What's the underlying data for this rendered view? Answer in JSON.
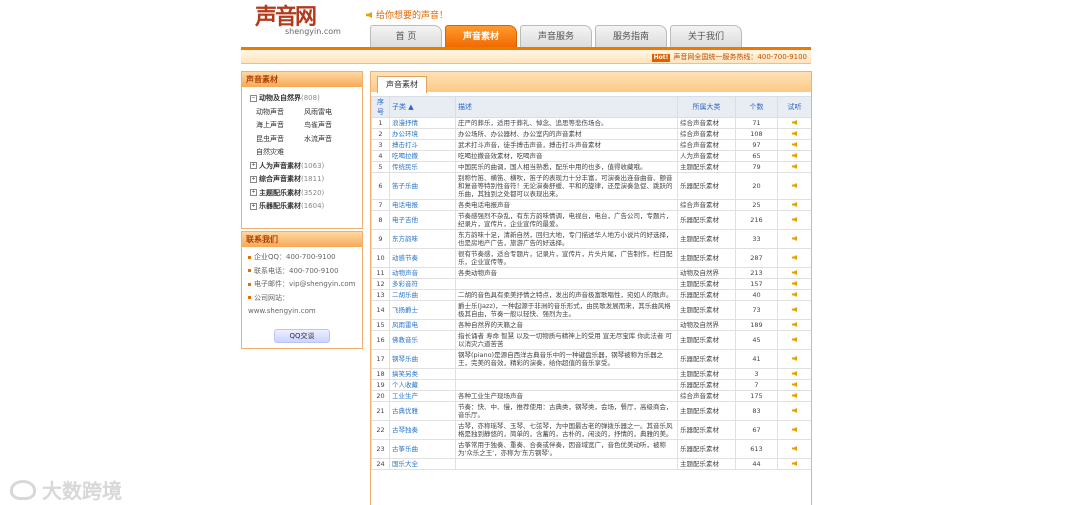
{
  "header": {
    "logo_text": "声音网",
    "logo_sub": "shengyin.com",
    "slogan": "给你想要的声音！",
    "hotline_badge": "Hot!",
    "hotline": "声音网全国统一服务热线：400-700-9100"
  },
  "nav": {
    "tabs": [
      {
        "label": "首 页"
      },
      {
        "label": "声音素材",
        "active": true
      },
      {
        "label": "声音服务"
      },
      {
        "label": "服务指南"
      },
      {
        "label": "关于我们"
      }
    ]
  },
  "sidebar": {
    "title": "声音素材",
    "categories": [
      {
        "label": "动物及自然界",
        "count": "(808)",
        "expanded": true,
        "children": [
          "动物声音",
          "风雨雷电",
          "海上声音",
          "鸟雀声音",
          "昆虫声音",
          "水流声音",
          "自然灾难"
        ]
      },
      {
        "label": "人为声音素材",
        "count": "(1063)"
      },
      {
        "label": "综合声音素材",
        "count": "(1811)"
      },
      {
        "label": "主题配乐素材",
        "count": "(3520)"
      },
      {
        "label": "乐器配乐素材",
        "count": "(1604)"
      }
    ],
    "contact": {
      "title": "联系我们",
      "rows": [
        "企业QQ：400-700-9100",
        "联系电话：400-700-9100",
        "电子邮件：vip@shengyin.com",
        "公司网站：www.shengyin.com"
      ],
      "qq_button": "QQ交谈"
    }
  },
  "main": {
    "tab": "声音素材",
    "columns": [
      "序号",
      "子类 ▲",
      "描述",
      "所属大类",
      "个数",
      "试听"
    ],
    "rows": [
      {
        "num": "1",
        "name": "浪漫抒情",
        "desc": "庄严的葬乐，适用于葬礼、悼念、追思等悲伤场合。",
        "cat": "综合声音素材",
        "cnt": "71"
      },
      {
        "num": "2",
        "name": "办公环境",
        "desc": "办公场所、办公器材、办公室内的声音素材",
        "cat": "综合声音素材",
        "cnt": "108"
      },
      {
        "num": "3",
        "name": "搏击打斗",
        "desc": "武术打斗声音，徒手搏击声音，搏击打斗声音素材",
        "cat": "综合声音素材",
        "cnt": "97"
      },
      {
        "num": "4",
        "name": "吃喝拉撒",
        "desc": "吃喝拉撒音效素材，吃喝声音",
        "cat": "人为声音素材",
        "cnt": "65"
      },
      {
        "num": "5",
        "name": "传统民乐",
        "desc": "中国民乐的曲调，国人相当熟悉，配乐中用的也多，值得收藏哦。",
        "cat": "主题配乐素材",
        "cnt": "79"
      },
      {
        "num": "6",
        "name": "笛子乐曲",
        "desc": "别称竹笛、横笛、横吹，笛子的表现力十分丰富，可演奏出连音曲音、颤音和复音等特别性音符！无论演奏舒缓、平和的旋律，还是演奏急促、跳跃的乐曲，其独到之处都可以表现出来。",
        "cat": "乐器配乐素材",
        "cnt": "20"
      },
      {
        "num": "7",
        "name": "电话电报",
        "desc": "各类电话电报声音",
        "cat": "综合声音素材",
        "cnt": "25"
      },
      {
        "num": "8",
        "name": "电子吉他",
        "desc": "节奏感强烈不杂乱，有东方韵味情调，电视台，电台，广告公司，专题片，纪录片，宣传片，企业宣传的最爱。",
        "cat": "乐器配乐素材",
        "cnt": "216"
      },
      {
        "num": "9",
        "name": "东方韵味",
        "desc": "东方韵味十足，清新自然，回归大地，专门描述华人地方小说片的好选择，也是房地产广告，旅游广告的好选择。",
        "cat": "主题配乐素材",
        "cnt": "33"
      },
      {
        "num": "10",
        "name": "动感节奏",
        "desc": "很有节奏感，适合专题片，记录片，宣传片，片头片尾，广告制作，栏目配乐，企业宣传等。",
        "cat": "主题配乐素材",
        "cnt": "287"
      },
      {
        "num": "11",
        "name": "动物声音",
        "desc": "各类动物声音",
        "cat": "动物及自然界",
        "cnt": "213"
      },
      {
        "num": "12",
        "name": "多彩音符",
        "desc": "",
        "cat": "主题配乐素材",
        "cnt": "157"
      },
      {
        "num": "13",
        "name": "二胡乐曲",
        "desc": "二胡的音色具有柔美抒情之特点，发出的声音极富歌唱性，宛如人的歌声。",
        "cat": "乐器配乐素材",
        "cnt": "40"
      },
      {
        "num": "14",
        "name": "飞扬爵士",
        "desc": "爵士乐(Jazz)，一种起源于非洲的音乐形式，由民歌发展而来，其乐曲风格极其自由，节奏一般以轻快、强烈为主。",
        "cat": "主题配乐素材",
        "cnt": "73"
      },
      {
        "num": "15",
        "name": "风雨雷电",
        "desc": "各种自然界的天籁之音",
        "cat": "动物及自然界",
        "cnt": "189"
      },
      {
        "num": "16",
        "name": "佛教音乐",
        "desc": "指长诵者 寿命 智慧 以及一切物质与精神上的受用 宣无尽宝库 你此法者 可以消灾六道苦苦",
        "cat": "主题配乐素材",
        "cnt": "45"
      },
      {
        "num": "17",
        "name": "钢琴乐曲",
        "desc": "钢琴(piano)是源自西洋古典音乐中的一种键盘乐器，钢琴被称为乐器之王，完美的音效，精彩的演奏，给你超值的音乐享受。",
        "cat": "乐器配乐素材",
        "cnt": "41"
      },
      {
        "num": "18",
        "name": "搞笑另类",
        "desc": "",
        "cat": "主题配乐素材",
        "cnt": "3"
      },
      {
        "num": "19",
        "name": "个人收藏",
        "desc": "",
        "cat": "乐器配乐素材",
        "cnt": "7"
      },
      {
        "num": "20",
        "name": "工业生产",
        "desc": "各种工业生产现场声音",
        "cat": "综合声音素材",
        "cnt": "175"
      },
      {
        "num": "21",
        "name": "古典优雅",
        "desc": "节奏：快、中、慢，推荐使用：古典类，钢琴类，会场，餐厅，高级商会，音乐厅。",
        "cat": "主题配乐素材",
        "cnt": "83"
      },
      {
        "num": "22",
        "name": "古琴独奏",
        "desc": "古琴，亦称瑶琴、玉琴、七弦琴，为中国最古老的弹拨乐器之一。其音乐风格是独到静悠的，简单的，含蓄的，古朴的，闲淡的，抒情的，典雅的美。",
        "cat": "乐器配乐素材",
        "cnt": "67"
      },
      {
        "num": "23",
        "name": "古筝乐曲",
        "desc": "古筝常用于独奏、重奏、合奏或伴奏，因音域宽广，音色优美动听，被称为'众乐之王'，亦称为'东方钢琴'。",
        "cat": "乐器配乐素材",
        "cnt": "613"
      },
      {
        "num": "24",
        "name": "国乐大全",
        "desc": "",
        "cat": "主题配乐素材",
        "cnt": "44"
      }
    ]
  },
  "watermark": "大数跨境",
  "colors": {
    "accent": "#f07800",
    "link": "#2b76c7"
  }
}
